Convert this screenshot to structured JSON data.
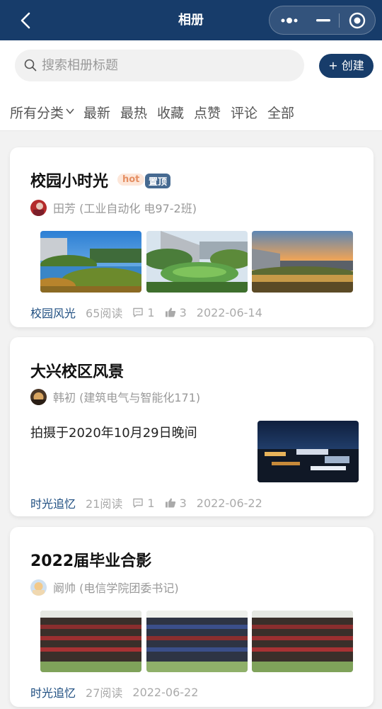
{
  "header": {
    "title": "相册"
  },
  "search": {
    "placeholder": "搜索相册标题",
    "value": ""
  },
  "create_label": "+ 创建",
  "tabs": [
    {
      "label": "所有分类"
    },
    {
      "label": "最新"
    },
    {
      "label": "最热"
    },
    {
      "label": "收藏"
    },
    {
      "label": "点赞"
    },
    {
      "label": "评论"
    },
    {
      "label": "全部"
    }
  ],
  "albums": [
    {
      "title": "校园小时光",
      "hot_badge": "hot",
      "top_badge": "置顶",
      "author": "田芳 (工业自动化 电97-2班)",
      "category": "校园风光",
      "reads": "65阅读",
      "comments": "1",
      "likes": "3",
      "date": "2022-06-14",
      "photos": [
        "campus-lake-photo",
        "campus-pond-photo",
        "campus-sunset-photo"
      ]
    },
    {
      "title": "大兴校区风景",
      "author": "韩初 (建筑电气与智能化171)",
      "description": "拍摄于2020年10月29日晚间",
      "category": "时光追忆",
      "reads": "21阅读",
      "comments": "1",
      "likes": "3",
      "date": "2022-06-22",
      "photos": [
        "campus-night-photo"
      ]
    },
    {
      "title": "2022届毕业合影",
      "author": "阚帅 (电信学院团委书记)",
      "category": "时光追忆",
      "reads": "27阅读",
      "date": "2022-06-22",
      "photos": [
        "graduation-group-photo",
        "graduation-group-photo",
        "graduation-group-photo"
      ]
    }
  ],
  "colors": {
    "brand": "#173c6a",
    "accent_text": "#1d4d80",
    "hot": "#e58f63",
    "top": "#466a91"
  }
}
